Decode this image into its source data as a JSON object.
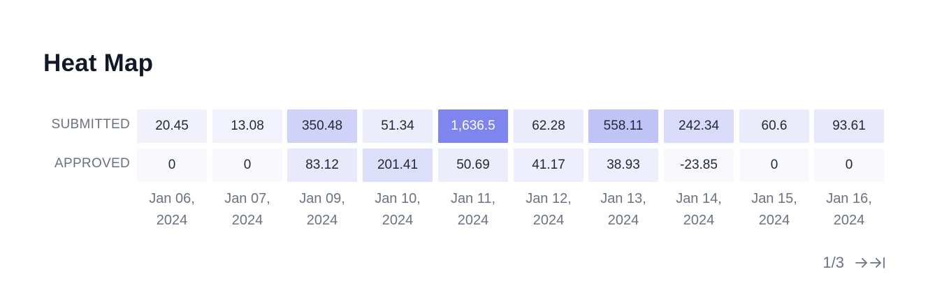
{
  "chart_data": {
    "type": "heatmap",
    "title": "Heat Map",
    "rows": [
      "SUBMITTED",
      "APPROVED"
    ],
    "columns": [
      [
        "Jan 06,",
        "2024"
      ],
      [
        "Jan 07,",
        "2024"
      ],
      [
        "Jan 09,",
        "2024"
      ],
      [
        "Jan 10,",
        "2024"
      ],
      [
        "Jan 11,",
        "2024"
      ],
      [
        "Jan 12,",
        "2024"
      ],
      [
        "Jan 13,",
        "2024"
      ],
      [
        "Jan 14,",
        "2024"
      ],
      [
        "Jan 15,",
        "2024"
      ],
      [
        "Jan 16,",
        "2024"
      ]
    ],
    "values": [
      [
        20.45,
        13.08,
        350.48,
        51.34,
        1636.5,
        62.28,
        558.11,
        242.34,
        60.6,
        93.61
      ],
      [
        0,
        0,
        83.12,
        201.41,
        50.69,
        41.17,
        38.93,
        -23.85,
        0,
        0
      ]
    ],
    "value_labels": [
      [
        "20.45",
        "13.08",
        "350.48",
        "51.34",
        "1,636.5",
        "62.28",
        "558.11",
        "242.34",
        "60.6",
        "93.61"
      ],
      [
        "0",
        "0",
        "83.12",
        "201.41",
        "50.69",
        "41.17",
        "38.93",
        "-23.85",
        "0",
        "0"
      ]
    ],
    "color_scale": {
      "low": "#ffffff",
      "high": "#7f85ef"
    }
  },
  "pagination": {
    "page_label": "1/3",
    "next_icon": "arrow-right-icon",
    "last_icon": "arrow-right-to-line-icon"
  }
}
